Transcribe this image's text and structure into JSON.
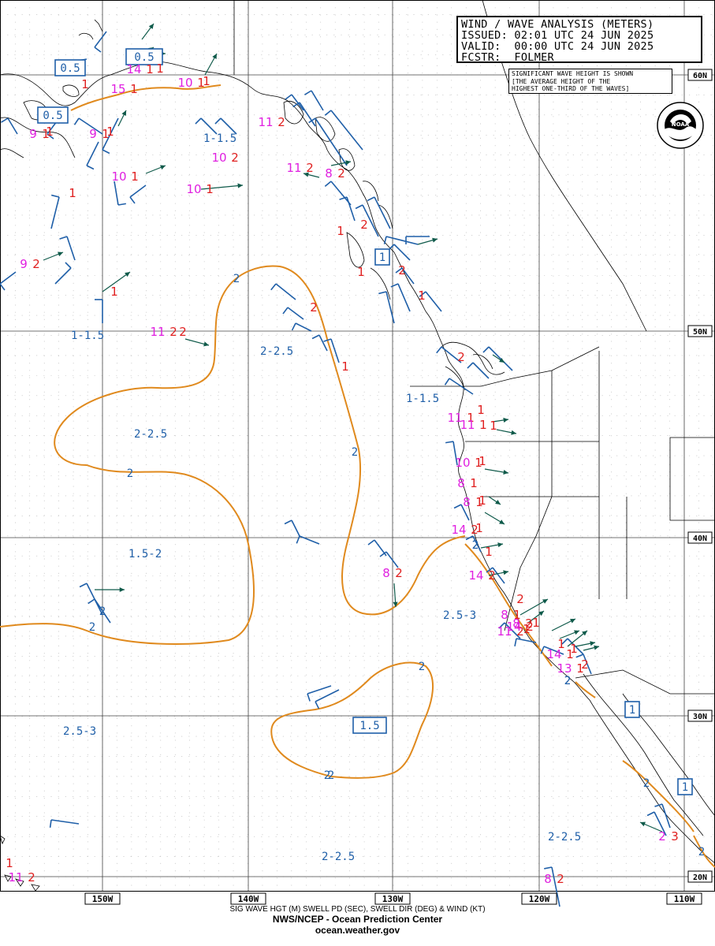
{
  "header": {
    "title": "WIND / WAVE ANALYSIS (METERS)",
    "issued": "ISSUED: 02:01 UTC 24 JUN 2025",
    "valid": "VALID:  00:00 UTC 24 JUN 2025",
    "fcstr": "FCSTR:  FOLMER"
  },
  "note": {
    "line1": "SIGNIFICANT WAVE HEIGHT IS SHOWN",
    "line2": "[THE AVERAGE HEIGHT OF THE",
    "line3": "HIGHEST ONE-THIRD OF THE WAVES]"
  },
  "logo": {
    "text": "NOAA",
    "icon": "noaa-logo-icon"
  },
  "footer": {
    "legend": "SIG WAVE HGT (M) SWELL PD (SEC), SWELL DIR (DEG) & WIND (KT)",
    "org": "NWS/NCEP - Ocean Prediction Center",
    "url": "ocean.weather.gov"
  },
  "lon_labels": [
    "150W",
    "140W",
    "130W",
    "120W",
    "110W"
  ],
  "lat_labels": [
    "60N",
    "50N",
    "40N",
    "30N",
    "20N"
  ],
  "colors": {
    "contour": "#e08a1e",
    "label_blue": "#1f5fa8",
    "period_magenta": "#e020e0",
    "height_red": "#e02020",
    "arrow": "#0f5a4a",
    "grid": "#333333",
    "coast": "#000000"
  },
  "boxed_values": [
    {
      "id": "box-0.5-a",
      "text": "0.5"
    },
    {
      "id": "box-0.5-b",
      "text": "0.5"
    },
    {
      "id": "box-0.5-c",
      "text": "0.5"
    },
    {
      "id": "box-1-bc",
      "text": "1"
    },
    {
      "id": "box-1.5",
      "text": "1.5"
    },
    {
      "id": "box-1-baja",
      "text": "1"
    },
    {
      "id": "box-1-mex",
      "text": "1"
    }
  ],
  "range_labels": [
    {
      "id": "r1",
      "text": "1-1.5"
    },
    {
      "id": "r2",
      "text": "1-1.5"
    },
    {
      "id": "r3",
      "text": "2-2.5"
    },
    {
      "id": "r4",
      "text": "2-2.5"
    },
    {
      "id": "r5",
      "text": "1-1.5"
    },
    {
      "id": "r6",
      "text": "1.5-2"
    },
    {
      "id": "r7",
      "text": "2.5-3"
    },
    {
      "id": "r8",
      "text": "2.5-3"
    },
    {
      "id": "r9",
      "text": "2-2.5"
    },
    {
      "id": "r10",
      "text": "2-2.5"
    }
  ],
  "contour_labels": [
    "2",
    "2",
    "2",
    "2",
    "2",
    "2",
    "2",
    "2",
    "2",
    "2",
    "2",
    "2",
    "2",
    "2"
  ],
  "swell_points": [
    {
      "period": "9",
      "height": "1"
    },
    {
      "period": "15",
      "height": "1"
    },
    {
      "period": "14",
      "height": "1"
    },
    {
      "period": "10",
      "height": "1"
    },
    {
      "period": "9",
      "height": "1"
    },
    {
      "period": "11",
      "height": "2"
    },
    {
      "period": "10",
      "height": "2"
    },
    {
      "period": "10",
      "height": "1"
    },
    {
      "period": "10",
      "height": "1"
    },
    {
      "period": "11",
      "height": "2"
    },
    {
      "period": "8",
      "height": "2"
    },
    {
      "period": "9",
      "height": "2"
    },
    {
      "period": "11",
      "height": "2"
    },
    {
      "period": "11",
      "height": "1"
    },
    {
      "period": "11",
      "height": "1"
    },
    {
      "period": "10",
      "height": "1"
    },
    {
      "period": "8",
      "height": "1"
    },
    {
      "period": "8",
      "height": "1"
    },
    {
      "period": "14",
      "height": "2"
    },
    {
      "period": "14",
      "height": "2"
    },
    {
      "period": "8",
      "height": "2"
    },
    {
      "period": "8",
      "height": "1"
    },
    {
      "period": "8",
      "height": "2"
    },
    {
      "period": "11",
      "height": "2"
    },
    {
      "period": "14",
      "height": "2"
    },
    {
      "period": "14",
      "height": "1"
    },
    {
      "period": "13",
      "height": "1"
    },
    {
      "period": "2",
      "height": "3"
    },
    {
      "period": "8",
      "height": "2"
    },
    {
      "period": "11",
      "height": "2"
    }
  ],
  "lone_heights": [
    "1",
    "1",
    "1",
    "1",
    "1",
    "1",
    "1",
    "2",
    "2",
    "1",
    "1",
    "1",
    "2",
    "2",
    "1",
    "2",
    "1",
    "1",
    "1",
    "1",
    "1",
    "1",
    "2",
    "1",
    "1",
    "1",
    "1",
    "2",
    "1"
  ]
}
